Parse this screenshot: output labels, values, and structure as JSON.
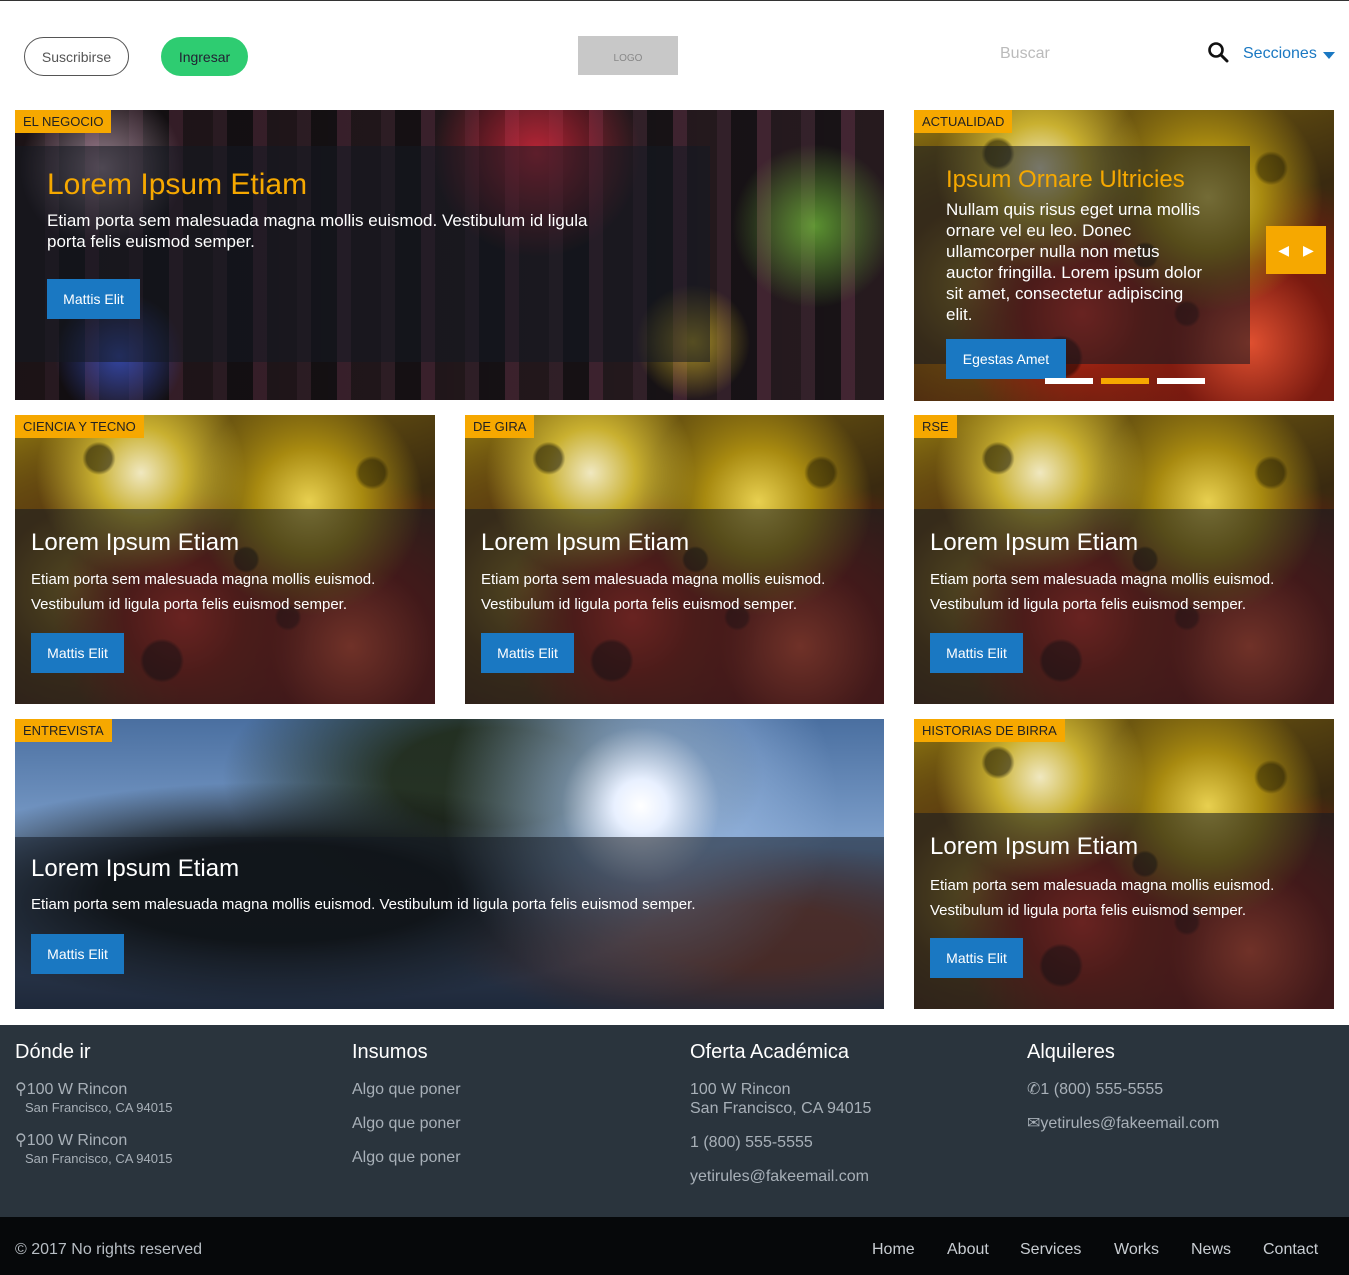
{
  "header": {
    "subscribe": "Suscribirse",
    "login": "Ingresar",
    "logo": "LOGO",
    "search_placeholder": "Buscar",
    "sections": "Secciones",
    "accent": "#1a78c2",
    "login_color": "#2ecc71"
  },
  "cards": [
    {
      "category": "EL NEGOCIO",
      "title": "Lorem Ipsum Etiam",
      "text": "Etiam porta sem malesuada magna mollis euismod. Vestibulum id ligula porta felis euismod semper.",
      "button": "Mattis Elit"
    },
    {
      "category": "ACTUALIDAD",
      "title": "Ipsum Ornare Ultricies",
      "text": "Nullam quis risus eget urna mollis ornare vel eu leo. Donec ullamcorper nulla non metus auctor fringilla. Lorem ipsum dolor sit amet, consectetur adipiscing elit.",
      "button": "Egestas Amet",
      "active_slide": 2,
      "slides": 3
    },
    {
      "category": "CIENCIA Y TECNO",
      "title": "Lorem Ipsum Etiam",
      "text": "Etiam porta sem malesuada magna mollis euismod. Vestibulum id ligula porta felis euismod semper.",
      "button": "Mattis Elit"
    },
    {
      "category": "DE GIRA",
      "title": "Lorem Ipsum Etiam",
      "text": "Etiam porta sem malesuada magna mollis euismod. Vestibulum id ligula porta felis euismod semper.",
      "button": "Mattis Elit"
    },
    {
      "category": "RSE",
      "title": "Lorem Ipsum Etiam",
      "text": "Etiam porta sem malesuada magna mollis euismod. Vestibulum id ligula porta felis euismod semper.",
      "button": "Mattis Elit"
    },
    {
      "category": "ENTREVISTA",
      "title": "Lorem Ipsum Etiam",
      "text": "Etiam porta sem malesuada magna mollis euismod. Vestibulum id ligula porta felis euismod semper.",
      "button": "Mattis Elit"
    },
    {
      "category": "HISTORIAS DE BIRRA",
      "title": "Lorem Ipsum Etiam",
      "text": "Etiam porta sem malesuada magna mollis euismod. Vestibulum id ligula porta felis euismod semper.",
      "button": "Mattis Elit"
    }
  ],
  "footer": {
    "col1": {
      "title": "Dónde ir",
      "a1": "100 W Rincon",
      "a1b": "San Francisco, CA 94015",
      "a2": "100 W Rincon",
      "a2b": "San Francisco, CA 94015"
    },
    "col2": {
      "title": "Insumos",
      "items": [
        "Algo que poner",
        "Algo que poner",
        "Algo que poner"
      ]
    },
    "col3": {
      "title": "Oferta Académica",
      "l1": "100 W Rincon",
      "l2": "San Francisco, CA 94015",
      "phone": "1 (800) 555-5555",
      "email": "yetirules@fakeemail.com"
    },
    "col4": {
      "title": "Alquileres",
      "phone": "1 (800) 555-5555",
      "email": "yetirules@fakeemail.com"
    }
  },
  "bottom": {
    "copyright": "© 2017 No rights reserved",
    "nav": [
      "Home",
      "About",
      "Services",
      "Works",
      "News",
      "Contact"
    ]
  },
  "colors": {
    "category_bg": "#f6a800",
    "title_orange": "#f6a800",
    "button": "#1a78c2",
    "footer_bg": "#2a343d",
    "bottom_bg": "#06080a"
  }
}
